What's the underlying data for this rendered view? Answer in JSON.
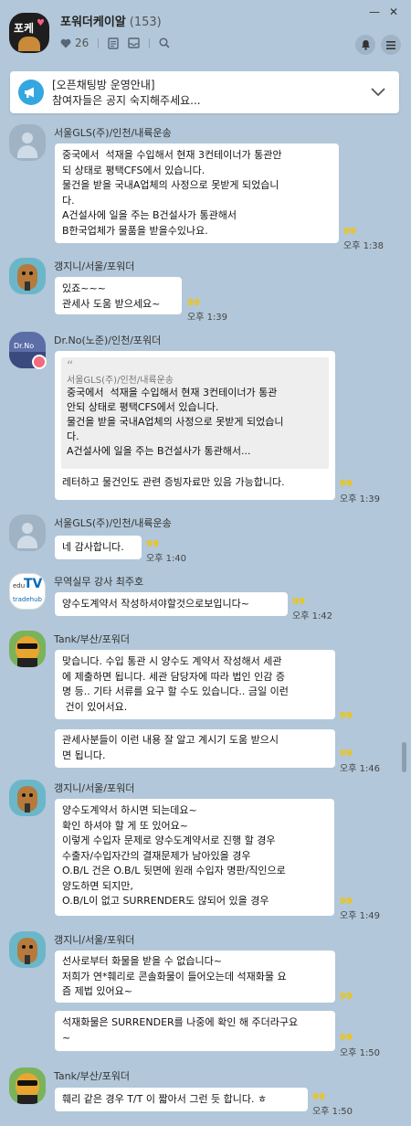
{
  "header": {
    "room_title": "포워더케이알",
    "member_count": "(153)",
    "like_count": "26",
    "avatar_text": "포케"
  },
  "window": {
    "minimize": "—",
    "close": "✕"
  },
  "notice": {
    "line1": "[오픈채팅방 운영안내]",
    "line2": "참여자들은 공지 숙지해주세요..."
  },
  "messages": [
    {
      "sender": "서울GLS(주)/인천/내륙운송",
      "text": "중국에서  석재을 수입해서 현재 3컨테이너가 통관안\n되 상태로 평택CFS에서 있습니다.\n물건을 받을 국내A업체의 사정으로 못받게 되었습니\n다.\nA건설사에 일을 주는 B건설사가 통관해서\nB한국업체가 물품을 받을수있나요.",
      "unread": "99",
      "time": "오후 1:38"
    },
    {
      "sender": "갱지니/서울/포워더",
      "text": "있죠~~~\n관세사 도움 받으세요~",
      "unread": "99",
      "time": "오후 1:39"
    },
    {
      "sender": "Dr.No(노준)/인천/포워더",
      "quote_sender": "서울GLS(주)/인천/내륙운송",
      "quote_text": "중국에서  석재을 수입해서 현재 3컨테이너가 통관\n안되 상태로 평택CFS에서 있습니다.\n물건을 받을 국내A업체의 사정으로 못받게 되었습니\n다.\nA건설사에 일을 주는 B건설사가 통관해서...",
      "text": "레터하고 물건인도 관련 증빙자료만 있음 가능합니다.",
      "unread": "99",
      "time": "오후 1:39"
    },
    {
      "sender": "서울GLS(주)/인천/내륙운송",
      "text": "네 감사합니다.",
      "unread": "99",
      "time": "오후 1:40"
    },
    {
      "sender": "무역실무 강사 최주호",
      "text": "양수도계약서 작성하셔야할것으로보입니다~",
      "unread": "99",
      "time": "오후 1:42"
    },
    {
      "sender": "Tank/부산/포워더",
      "text": "맞습니다. 수입 통관 시 양수도 계약서 작성해서 세관\n에 제출하면 됩니다. 세관 담당자에 따라 법인 인감 증\n명 등.. 기타 서류를 요구 할 수도 있습니다.. 금일 이런\n 건이 있어서요.",
      "unread": "99",
      "time": ""
    },
    {
      "sender": "",
      "text": "관세사분들이 이런 내용 잘 알고 계시기 도움 받으시\n면 됩니다.",
      "unread": "99",
      "time": "오후 1:46"
    },
    {
      "sender": "갱지니/서울/포워더",
      "text": "양수도계약서 하시면 되는데요~\n확인 하셔야 할 게 또 있어요~\n이렇게 수입자 문제로 양수도계약서로 진행 할 경우\n수출자/수입자간의 결재문제가 남아있을 경우\nO.B/L 건은 O.B/L 뒷면에 원래 수입자 명판/직인으로\n양도하면 되지만,\nO.B/L이 없고 SURRENDER도 않되어 있을 경우",
      "unread": "99",
      "time": "오후 1:49"
    },
    {
      "sender": "갱지니/서울/포워더",
      "text": "선사로부터 화물을 받을 수 없습니다~\n저희가 연*훼리로 콘솔화물이 들어오는데 석재화물 요\n즘 제법 있어요~",
      "unread": "99",
      "time": ""
    },
    {
      "sender": "",
      "text": "석재화물은 SURRENDER를 나중에 확인 해 주더라구요\n~",
      "unread": "99",
      "time": "오후 1:50"
    },
    {
      "sender": "Tank/부산/포워더",
      "text": "훼리 같은 경우 T/T 이 짧아서 그런 듯 합니다. ㅎ",
      "unread": "99",
      "time": "오후 1:50"
    }
  ]
}
